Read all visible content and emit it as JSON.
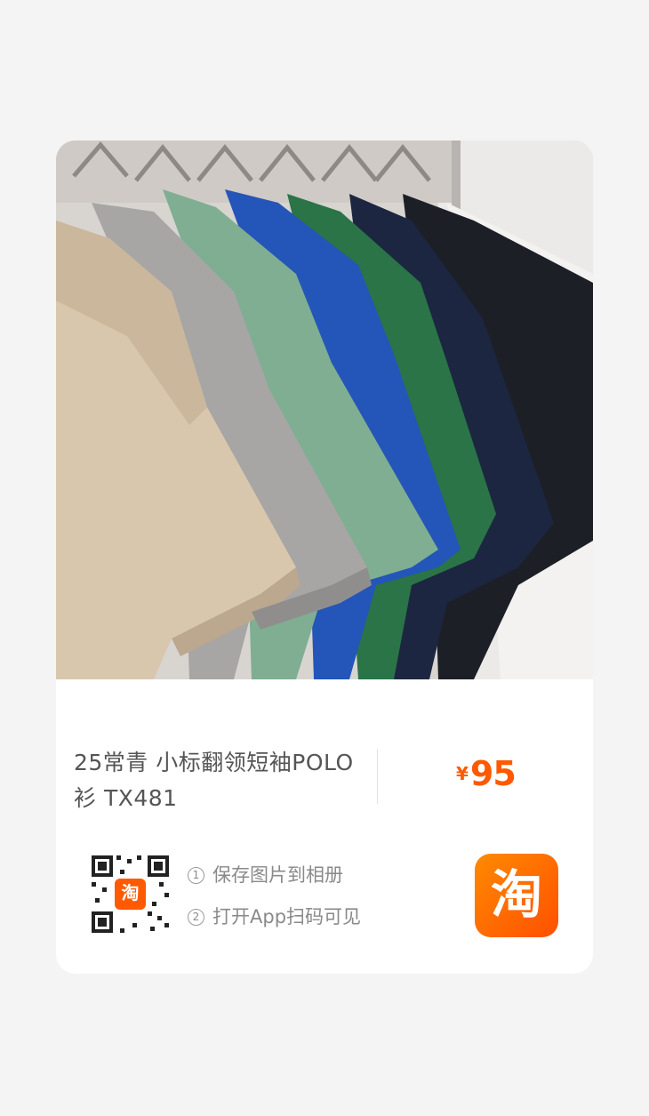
{
  "product": {
    "title": "25常青 小标翻领短袖POLO衫 TX481",
    "currency_symbol": "¥",
    "price": "95",
    "image_description": "colorful-polo-shirts-on-hangers"
  },
  "share": {
    "step1_num": "1",
    "step1_text": "保存图片到相册",
    "step2_num": "2",
    "step2_text": "打开App扫码可见",
    "qr_badge_glyph": "淘",
    "app_icon_glyph": "淘"
  },
  "colors": {
    "accent": "#ff5a00",
    "background": "#f4f4f4",
    "card": "#ffffff"
  }
}
